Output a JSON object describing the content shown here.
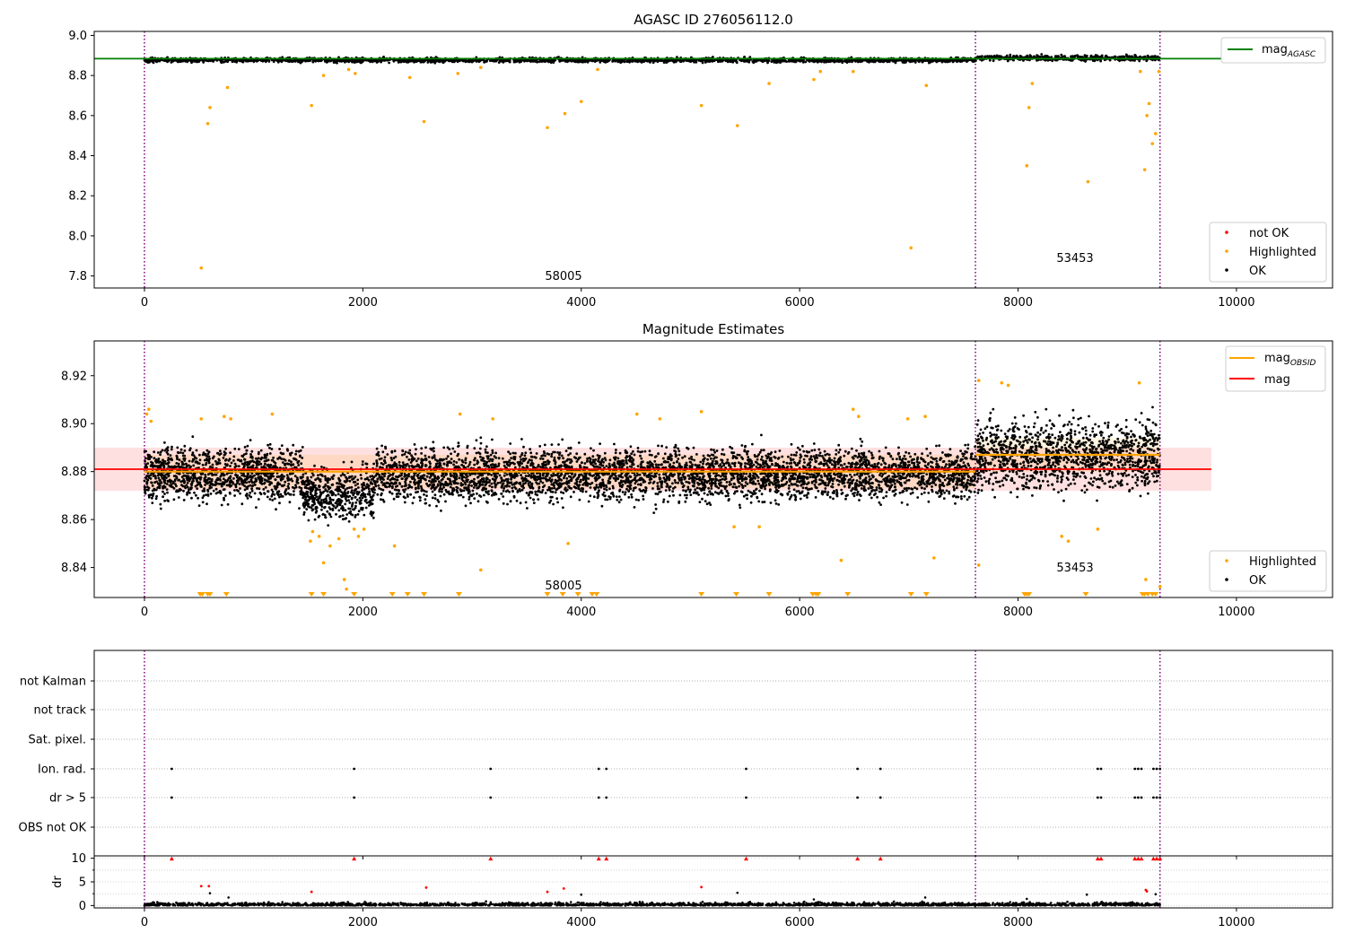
{
  "chart_data": [
    {
      "type": "scatter",
      "title": "AGASC ID 276056112.0",
      "xlim": [
        -460,
        10880
      ],
      "ylim": [
        7.74,
        9.02
      ],
      "xticks": [
        0,
        2000,
        4000,
        6000,
        8000,
        10000
      ],
      "yticks": [
        7.8,
        8.0,
        8.2,
        8.4,
        8.6,
        8.8,
        9.0
      ],
      "ytick_labels": [
        "7.8",
        "8.0",
        "8.2",
        "8.4",
        "8.6",
        "8.8",
        "9.0"
      ],
      "vlines": [
        0,
        7610,
        9300
      ],
      "obsid_labels": [
        {
          "text": "58005",
          "x": 3790,
          "y": 7.77
        },
        {
          "text": "53453",
          "x": 8450,
          "y": 7.86
        }
      ],
      "mag_agasc": 8.884,
      "line_legend": {
        "base": "mag",
        "sub": "AGASC"
      },
      "ok_band": [
        {
          "x0": 0,
          "x1": 7610,
          "center": 8.877,
          "spread": 0.012
        },
        {
          "x0": 7610,
          "x1": 9300,
          "center": 8.887,
          "spread": 0.014
        }
      ],
      "highlighted": [
        [
          520,
          7.84
        ],
        [
          580,
          8.56
        ],
        [
          600,
          8.64
        ],
        [
          760,
          8.74
        ],
        [
          1530,
          8.65
        ],
        [
          2560,
          8.57
        ],
        [
          3690,
          8.54
        ],
        [
          3850,
          8.61
        ],
        [
          4000,
          8.67
        ],
        [
          5100,
          8.65
        ],
        [
          5430,
          8.55
        ],
        [
          5720,
          8.76
        ],
        [
          6130,
          8.78
        ],
        [
          7020,
          7.94
        ],
        [
          7160,
          8.75
        ],
        [
          8080,
          8.35
        ],
        [
          8100,
          8.64
        ],
        [
          8130,
          8.76
        ],
        [
          8640,
          8.27
        ],
        [
          9160,
          8.33
        ],
        [
          9180,
          8.6
        ],
        [
          9200,
          8.66
        ],
        [
          9230,
          8.46
        ],
        [
          9260,
          8.51
        ],
        [
          9290,
          8.82
        ],
        [
          2870,
          8.81
        ],
        [
          1640,
          8.8
        ],
        [
          1930,
          8.81
        ],
        [
          1870,
          8.83
        ],
        [
          2430,
          8.79
        ],
        [
          3080,
          8.84
        ],
        [
          6190,
          8.82
        ],
        [
          9120,
          8.82
        ],
        [
          4150,
          8.83
        ],
        [
          6490,
          8.82
        ]
      ],
      "legend": [
        {
          "label": "not OK",
          "color": "#ff0000"
        },
        {
          "label": "Highlighted",
          "color": "#ffa500"
        },
        {
          "label": "OK",
          "color": "#000000"
        }
      ]
    },
    {
      "type": "scatter",
      "title": "Magnitude Estimates",
      "xlim": [
        -460,
        10880
      ],
      "ylim": [
        8.8275,
        8.9345
      ],
      "xticks": [
        0,
        2000,
        4000,
        6000,
        8000,
        10000
      ],
      "yticks": [
        8.84,
        8.86,
        8.88,
        8.9,
        8.92
      ],
      "ytick_labels": [
        "8.84",
        "8.86",
        "8.88",
        "8.90",
        "8.92"
      ],
      "vlines": [
        0,
        7610,
        9300
      ],
      "obsid_labels": [
        {
          "text": "58005",
          "x": 3790,
          "y": 8.832
        },
        {
          "text": "53453",
          "x": 8450,
          "y": 8.839
        }
      ],
      "mag": 8.881,
      "mag_band": [
        8.872,
        8.89
      ],
      "mag_span": [
        -460,
        9770
      ],
      "mag_obsid": [
        {
          "x0": 0,
          "x1": 7610,
          "value": 8.88
        },
        {
          "x0": 7610,
          "x1": 9300,
          "value": 8.887
        }
      ],
      "ok_band": [
        {
          "x0": 0,
          "x1": 7610,
          "center": 8.879,
          "spread": 0.0085
        },
        {
          "x0": 7610,
          "x1": 9300,
          "center": 8.887,
          "spread": 0.011
        }
      ],
      "highlighted": [
        [
          20,
          8.904
        ],
        [
          40,
          8.906
        ],
        [
          60,
          8.901
        ],
        [
          520,
          8.902
        ],
        [
          730,
          8.903
        ],
        [
          790,
          8.902
        ],
        [
          1170,
          8.904
        ],
        [
          1520,
          8.851
        ],
        [
          1540,
          8.855
        ],
        [
          1600,
          8.853
        ],
        [
          1640,
          8.842
        ],
        [
          1700,
          8.849
        ],
        [
          1780,
          8.852
        ],
        [
          1830,
          8.835
        ],
        [
          1850,
          8.831
        ],
        [
          1920,
          8.856
        ],
        [
          1960,
          8.853
        ],
        [
          2010,
          8.856
        ],
        [
          2290,
          8.849
        ],
        [
          2890,
          8.904
        ],
        [
          3080,
          8.839
        ],
        [
          3190,
          8.902
        ],
        [
          3880,
          8.85
        ],
        [
          4510,
          8.904
        ],
        [
          4720,
          8.902
        ],
        [
          5100,
          8.905
        ],
        [
          5400,
          8.857
        ],
        [
          5630,
          8.857
        ],
        [
          6380,
          8.843
        ],
        [
          6490,
          8.906
        ],
        [
          6540,
          8.903
        ],
        [
          6990,
          8.902
        ],
        [
          7150,
          8.903
        ],
        [
          7230,
          8.844
        ],
        [
          7640,
          8.918
        ],
        [
          7640,
          8.841
        ],
        [
          7850,
          8.917
        ],
        [
          7910,
          8.916
        ],
        [
          8400,
          8.853
        ],
        [
          8460,
          8.851
        ],
        [
          8730,
          8.856
        ],
        [
          9110,
          8.917
        ],
        [
          9170,
          8.835
        ],
        [
          9300,
          8.832
        ]
      ],
      "below_markers": [
        510,
        530,
        580,
        600,
        750,
        1530,
        1640,
        1920,
        2270,
        2410,
        2560,
        2880,
        3690,
        3830,
        3970,
        4100,
        4140,
        5100,
        5420,
        5720,
        6120,
        6150,
        6170,
        6440,
        7020,
        7160,
        8060,
        8080,
        8100,
        8620,
        9140,
        9160,
        9190,
        9230,
        9260
      ],
      "legend": [
        {
          "label": "Highlighted",
          "color": "#ffa500"
        },
        {
          "label": "OK",
          "color": "#000000"
        }
      ],
      "line_legend": [
        {
          "base": "mag",
          "sub": "OBSID",
          "color": "#ffa500"
        },
        {
          "base": "mag",
          "sub": "",
          "color": "#ff0000"
        }
      ]
    },
    {
      "type": "scatter",
      "xlim": [
        -460,
        10880
      ],
      "vlines": [
        0,
        7610,
        9300
      ],
      "flag_rows": [
        "not Kalman",
        "not track",
        "Sat. pixel.",
        "Ion. rad.",
        "dr > 5",
        "OBS not OK"
      ],
      "ion_rad_times": [
        250,
        1920,
        3170,
        4160,
        4230,
        5510,
        6530,
        6740,
        8730,
        8760,
        9070,
        9100,
        9130,
        9240,
        9270,
        9300
      ],
      "dr_gt5_times": [
        250,
        1920,
        3170,
        4160,
        4230,
        5510,
        6530,
        6740,
        8730,
        8760,
        9070,
        9100,
        9130,
        9240,
        9270,
        9300
      ],
      "dr_ylim": [
        -0.5,
        10.5
      ],
      "dr_yticks": [
        0,
        5,
        10
      ],
      "dr_ylabel": "dr",
      "dr_capped_times": [
        250,
        1920,
        3170,
        4160,
        4230,
        5510,
        6530,
        6740,
        8730,
        8760,
        9070,
        9100,
        9130,
        9240,
        9270,
        9300
      ],
      "dr_high": [
        [
          520,
          4.1
        ],
        [
          590,
          4.1
        ],
        [
          1530,
          2.9
        ],
        [
          2580,
          3.8
        ],
        [
          3690,
          2.9
        ],
        [
          3840,
          3.6
        ],
        [
          5100,
          3.9
        ],
        [
          9170,
          3.3
        ],
        [
          9180,
          3.0
        ]
      ],
      "dr_mid": [
        [
          600,
          2.6
        ],
        [
          770,
          1.7
        ],
        [
          4000,
          2.3
        ],
        [
          5430,
          2.7
        ],
        [
          6130,
          1.3
        ],
        [
          7150,
          1.7
        ],
        [
          8080,
          1.4
        ],
        [
          8630,
          2.3
        ],
        [
          9260,
          2.4
        ]
      ],
      "xticks": [
        0,
        2000,
        4000,
        6000,
        8000,
        10000
      ]
    }
  ]
}
